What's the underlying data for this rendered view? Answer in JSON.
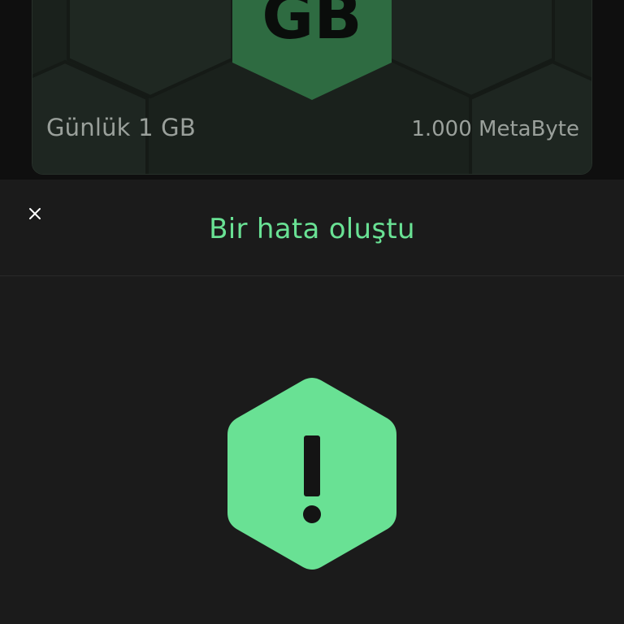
{
  "background_card": {
    "logo_text": "GB",
    "name": "Günlük 1 GB",
    "price": "1.000 MetaByte"
  },
  "error_sheet": {
    "title": "Bir hata oluştu",
    "close_icon": "close-icon",
    "status_icon": "alert-hexagon-icon",
    "status_glyph": "!"
  },
  "colors": {
    "accent": "#69e194",
    "sheet_background": "#1b1b1b",
    "overlay_background": "#0f0f0f"
  }
}
